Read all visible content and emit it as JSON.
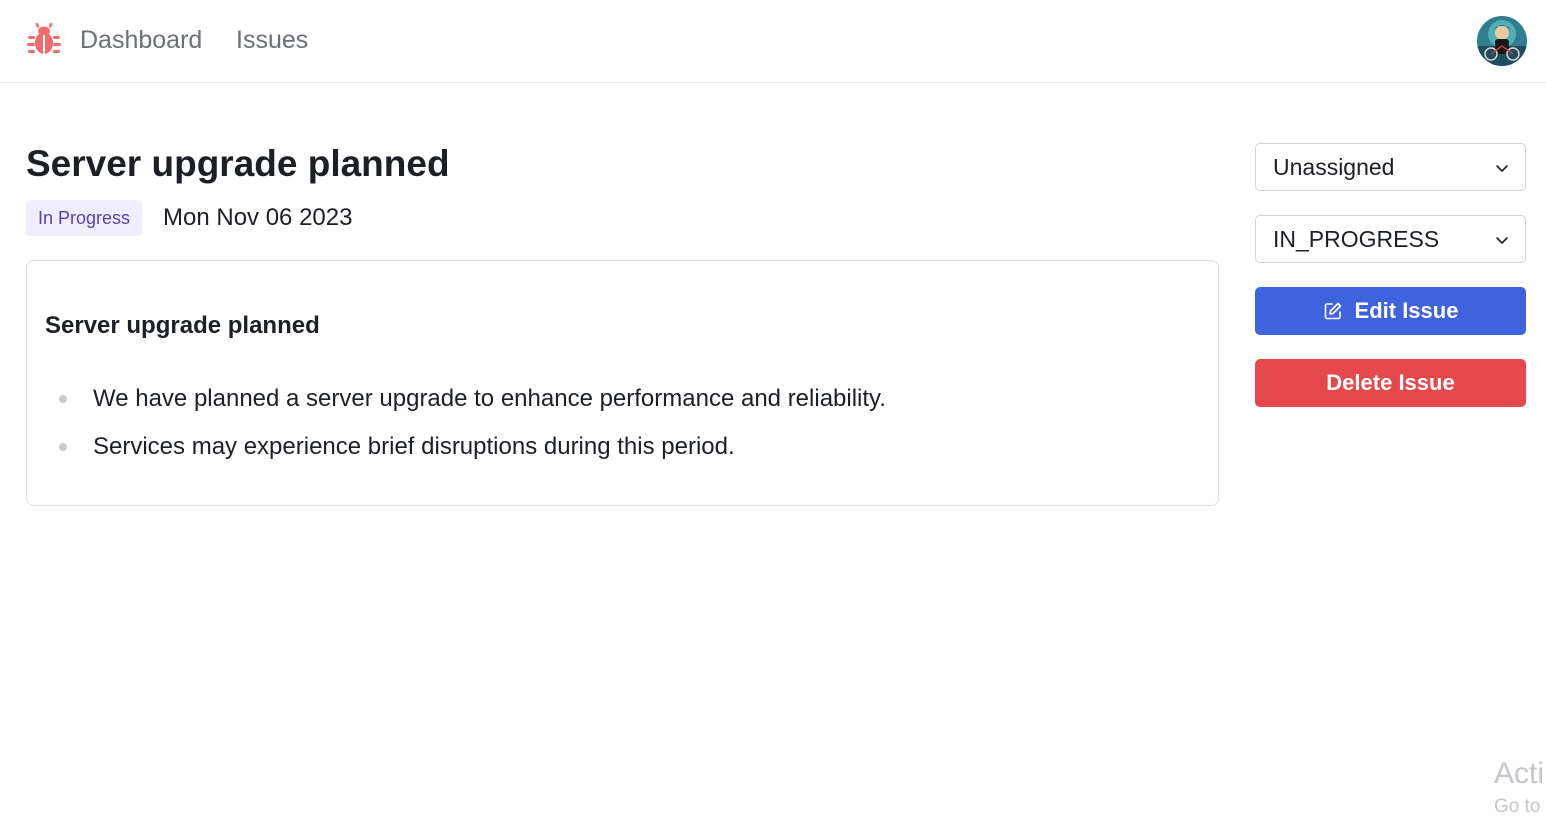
{
  "navbar": {
    "logo_icon": "bug-icon",
    "logo_color": "#f06b6b",
    "links": [
      {
        "label": "Dashboard"
      },
      {
        "label": "Issues"
      }
    ],
    "avatar_icon": "user-avatar"
  },
  "issue": {
    "title": "Server upgrade planned",
    "status_badge": "In Progress",
    "date": "Mon Nov 06 2023",
    "body": {
      "heading": "Server upgrade planned",
      "bullets": [
        "We have planned a server upgrade to enhance performance and reliability.",
        "Services may experience brief disruptions during this period."
      ]
    }
  },
  "sidebar": {
    "assignee_select": {
      "value": "Unassigned",
      "icon": "chevron-down-icon"
    },
    "status_select": {
      "value": "IN_PROGRESS",
      "icon": "chevron-down-icon"
    },
    "edit_button": {
      "label": "Edit Issue",
      "icon": "edit-icon"
    },
    "delete_button": {
      "label": "Delete Issue"
    }
  },
  "watermark": {
    "title": "Acti",
    "subtitle": "Go to"
  },
  "colors": {
    "accent": "#3e63dd",
    "danger": "#e5484d",
    "badge_bg": "#f0eefe",
    "badge_text": "#5b3fb0"
  }
}
